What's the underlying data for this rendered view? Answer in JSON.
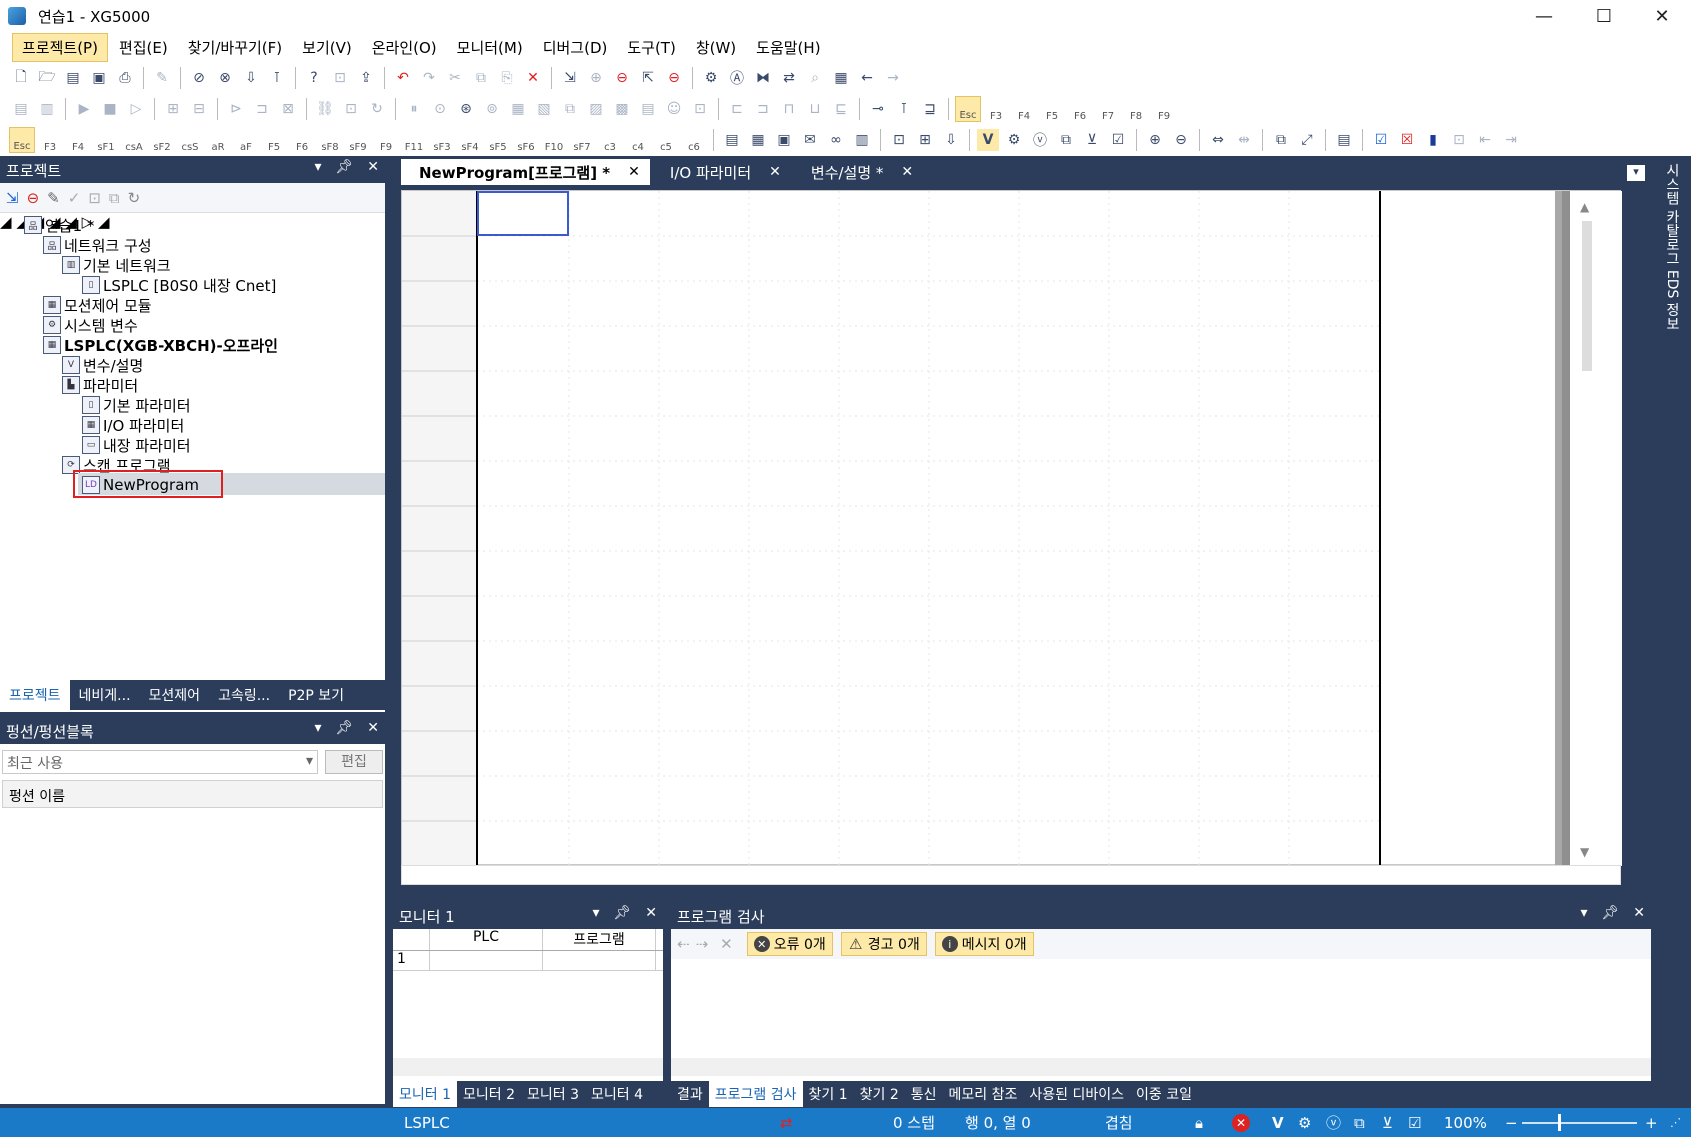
{
  "window": {
    "title": "연습1 - XG5000",
    "min": "—",
    "max": "☐",
    "close": "✕"
  },
  "menu": [
    "프로젝트(P)",
    "편집(E)",
    "찾기/바꾸기(F)",
    "보기(V)",
    "온라인(O)",
    "모니터(M)",
    "디버그(D)",
    "도구(T)",
    "창(W)",
    "도움말(H)"
  ],
  "fkeys_row2": [
    "Esc",
    "F3",
    "F4",
    "F5",
    "F6",
    "F7",
    "F8",
    "F9"
  ],
  "fkeys_row3": [
    "Esc",
    "F3",
    "F4",
    "sF1",
    "csA",
    "sF2",
    "csS",
    "aR",
    "aF",
    "F5",
    "F6",
    "sF8",
    "sF9",
    "F9",
    "F11",
    "sF3",
    "sF4",
    "sF5",
    "sF6",
    "F10",
    "sF7",
    "c3",
    "c4",
    "c5",
    "c6"
  ],
  "project_panel": {
    "title": "프로젝트",
    "tree": [
      {
        "label": "연습1 *",
        "level": 0
      },
      {
        "label": "네트워크 구성",
        "level": 1
      },
      {
        "label": "기본 네트워크",
        "level": 2
      },
      {
        "label": "LSPLC [B0S0 내장 Cnet]",
        "level": 3
      },
      {
        "label": "모션제어 모듈",
        "level": 1
      },
      {
        "label": "시스템 변수",
        "level": 1
      },
      {
        "label": "LSPLC(XGB-XBCH)-오프라인",
        "level": 1
      },
      {
        "label": "변수/설명",
        "level": 2
      },
      {
        "label": "파라미터",
        "level": 2
      },
      {
        "label": "기본 파라미터",
        "level": 3
      },
      {
        "label": "I/O 파라미터",
        "level": 3
      },
      {
        "label": "내장 파라미터",
        "level": 3
      },
      {
        "label": "스캔 프로그램",
        "level": 2
      },
      {
        "label": "NewProgram",
        "level": 3
      }
    ],
    "tabs": [
      "프로젝트",
      "네비게...",
      "모션제어",
      "고속링...",
      "P2P 보기"
    ]
  },
  "func_panel": {
    "title": "펑션/펑션블록",
    "combo_value": "최근 사용",
    "edit_button": "편집",
    "column": "펑션 이름"
  },
  "doc_tabs": [
    {
      "label": "NewProgram[프로그램] *",
      "active": true
    },
    {
      "label": "I/O 파라미터",
      "active": false
    },
    {
      "label": "변수/설명 *",
      "active": false
    }
  ],
  "monitor": {
    "title": "모니터 1",
    "columns": [
      "PLC",
      "프로그램"
    ],
    "row_number": "1",
    "tabs": [
      "모니터 1",
      "모니터 2",
      "모니터 3",
      "모니터 4"
    ]
  },
  "program_check": {
    "title": "프로그램 검사",
    "errors": "오류 0개",
    "warnings": "경고 0개",
    "messages": "메시지 0개",
    "tabs": [
      "결과",
      "프로그램 검사",
      "찾기 1",
      "찾기 2",
      "통신",
      "메모리 참조",
      "사용된 디바이스",
      "이중 코일"
    ]
  },
  "right_dock": "시스템 카탈로그  EDS 정보",
  "status": {
    "plc": "LSPLC",
    "steps": "0 스텝",
    "position": "행 0, 열 0",
    "mode": "겹침",
    "zoom": "100%"
  },
  "colors": {
    "dark": "#2b3d5b",
    "status": "#1b7ac7",
    "highlight": "#fde9a8",
    "selection_box": "#e02020"
  }
}
